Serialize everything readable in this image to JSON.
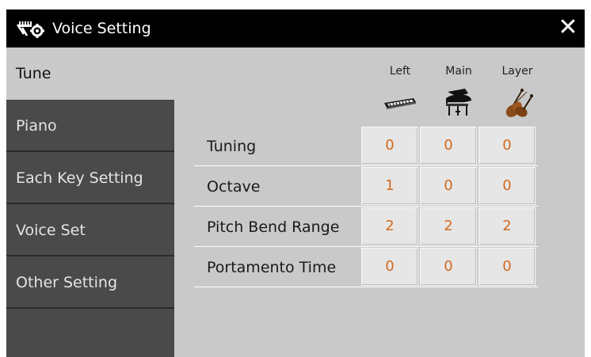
{
  "window": {
    "title": "Voice Setting",
    "title_icon": "voice-setting-icon",
    "close_glyph": "✕"
  },
  "sidebar": {
    "items": [
      {
        "label": "Tune",
        "active": true
      },
      {
        "label": "Piano",
        "active": false
      },
      {
        "label": "Each Key Setting",
        "active": false
      },
      {
        "label": "Voice Set",
        "active": false
      },
      {
        "label": "Other Setting",
        "active": false
      }
    ]
  },
  "columns": [
    {
      "label": "Left",
      "icon": "keyboard-icon"
    },
    {
      "label": "Main",
      "icon": "grand-piano-icon"
    },
    {
      "label": "Layer",
      "icon": "violin-icon"
    }
  ],
  "rows": [
    {
      "label": "Tuning",
      "values": [
        "0",
        "0",
        "0"
      ]
    },
    {
      "label": "Octave",
      "values": [
        "1",
        "0",
        "0"
      ]
    },
    {
      "label": "Pitch Bend Range",
      "values": [
        "2",
        "2",
        "2"
      ]
    },
    {
      "label": "Portamento Time",
      "values": [
        "0",
        "0",
        "0"
      ]
    }
  ],
  "colors": {
    "value_text": "#d2691e",
    "title_bar": "#000000",
    "sidebar": "#4a4a4a",
    "panel": "#c9c9c9"
  }
}
